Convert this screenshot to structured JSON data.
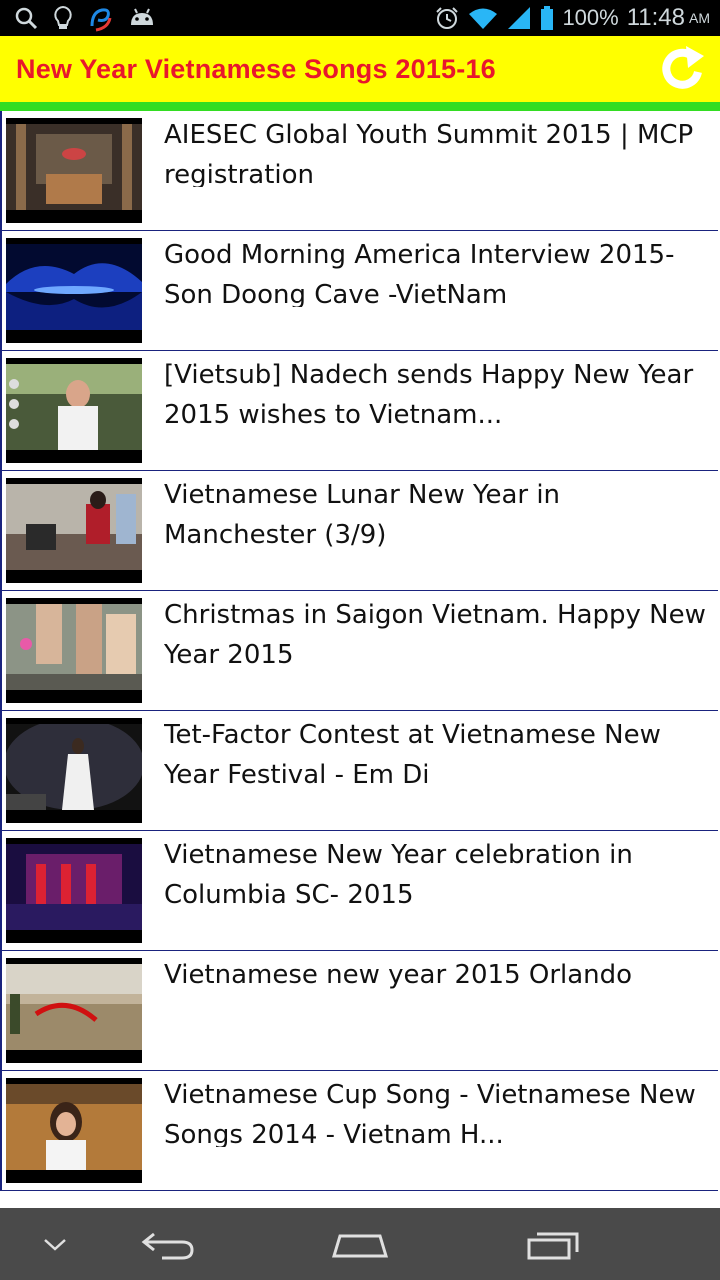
{
  "status_bar": {
    "icons_left": [
      "search-icon",
      "lightbulb-icon",
      "app-logo-icon",
      "android-icon"
    ],
    "icons_right": [
      "alarm-icon",
      "wifi-icon",
      "signal-icon",
      "battery-icon"
    ],
    "battery_percent": "100%",
    "time": "11:48",
    "ampm": "AM"
  },
  "app_bar": {
    "title": "New Year Vietnamese Songs 2015-16",
    "background_color": "#ffff00",
    "title_color": "#e8172c",
    "accent_color": "#33dd22",
    "refresh_icon": "refresh-icon"
  },
  "videos": [
    {
      "title": "AIESEC Global Youth Summit 2015 | MCP registration"
    },
    {
      "title": "Good Morning America Interview 2015-Son Doong Cave -VietNam"
    },
    {
      "title": "[Vietsub] Nadech sends Happy New Year 2015 wishes to Vietnam..."
    },
    {
      "title": "Vietnamese Lunar New Year in Manchester (3/9)"
    },
    {
      "title": "Christmas in Saigon Vietnam. Happy New Year 2015"
    },
    {
      "title": "Tet-Factor Contest at Vietnamese New Year Festival - Em Di"
    },
    {
      "title": "Vietnamese New Year celebration in Columbia SC- 2015"
    },
    {
      "title": "Vietnamese new year 2015 Orlando"
    },
    {
      "title": "Vietnamese Cup Song  - Vietnamese New Songs 2014 - Vietnam H..."
    }
  ],
  "nav_bar": {
    "buttons": [
      "hide-keyboard-icon",
      "back-icon",
      "home-icon",
      "recent-apps-icon"
    ]
  }
}
